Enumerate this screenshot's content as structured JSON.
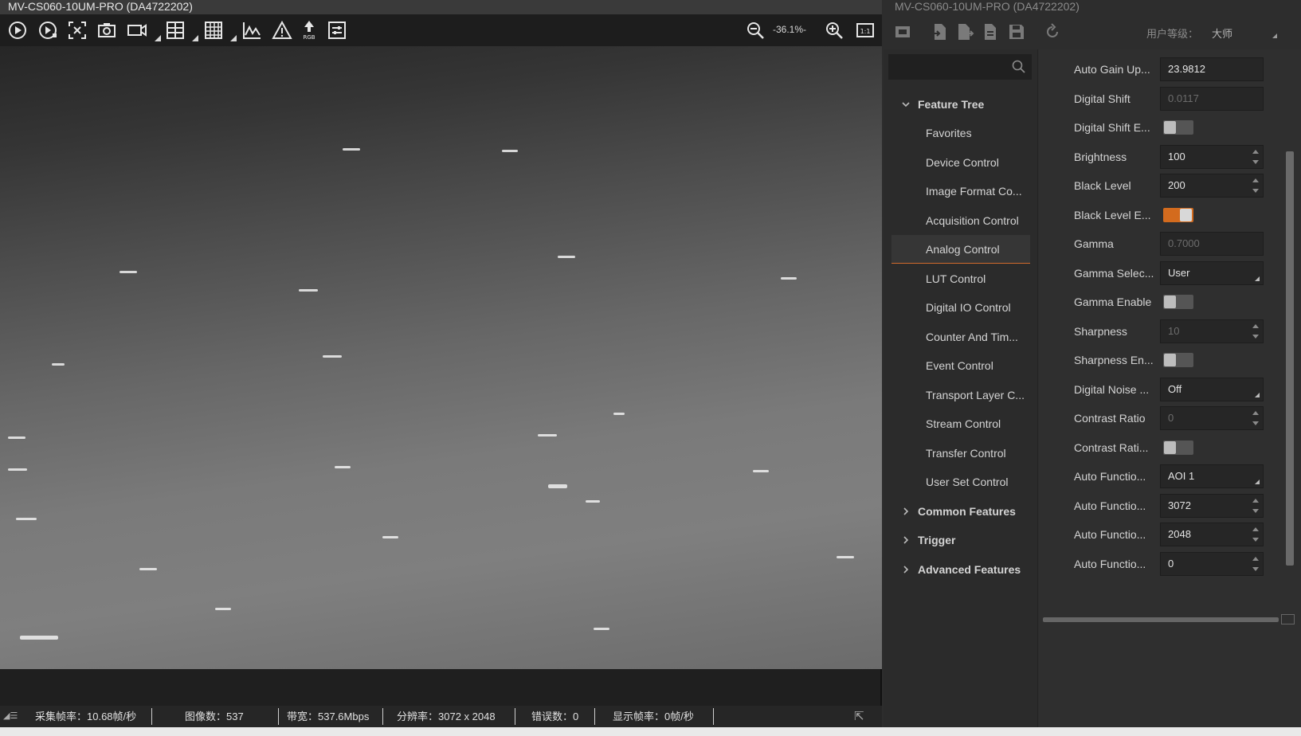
{
  "viewer": {
    "title": "MV-CS060-10UM-PRO (DA4722202)",
    "zoom": "-36.1%-",
    "toolbar": [
      "play-icon",
      "play-single-icon",
      "crosshair-icon",
      "camera-icon",
      "record-icon",
      "grid-small-icon",
      "grid-large-icon",
      "histogram-icon",
      "warning-icon",
      "rgb-icon",
      "settings-panel-icon"
    ]
  },
  "status": {
    "frame_rate": "采集帧率：10.68帧/秒",
    "image_count": "图像数：537",
    "bandwidth": "带宽：537.6Mbps",
    "resolution": "分辨率：3072 x 2048",
    "errors": "错误数：0",
    "display_rate": "显示帧率：0帧/秒"
  },
  "panel": {
    "title": "MV-CS060-10UM-PRO (DA4722202)",
    "user_level_label": "用户等级：",
    "user_level_value": "大师",
    "search_placeholder": ""
  },
  "tree": {
    "feature_tree": "Feature Tree",
    "children": [
      "Favorites",
      "Device Control",
      "Image Format Co...",
      "Acquisition Control",
      "Analog Control",
      "LUT Control",
      "Digital IO Control",
      "Counter And Tim...",
      "Event Control",
      "Transport Layer C...",
      "Stream Control",
      "Transfer Control",
      "User Set Control"
    ],
    "selected": "Analog Control",
    "groups": [
      "Common Features",
      "Trigger",
      "Advanced Features"
    ]
  },
  "props": [
    {
      "label": "Auto Gain Up...",
      "type": "text",
      "value": "23.9812",
      "disabled": false
    },
    {
      "label": "Digital Shift",
      "type": "text",
      "value": "0.0117",
      "disabled": true
    },
    {
      "label": "Digital Shift E...",
      "type": "toggle",
      "on": false
    },
    {
      "label": "Brightness",
      "type": "spin",
      "value": "100",
      "disabled": false
    },
    {
      "label": "Black Level",
      "type": "spin",
      "value": "200",
      "disabled": false
    },
    {
      "label": "Black Level E...",
      "type": "toggle",
      "on": true
    },
    {
      "label": "Gamma",
      "type": "text",
      "value": "0.7000",
      "disabled": true
    },
    {
      "label": "Gamma Selec...",
      "type": "combo",
      "value": "User",
      "disabled": false
    },
    {
      "label": "Gamma Enable",
      "type": "toggle",
      "on": false
    },
    {
      "label": "Sharpness",
      "type": "spin",
      "value": "10",
      "disabled": true
    },
    {
      "label": "Sharpness En...",
      "type": "toggle",
      "on": false
    },
    {
      "label": "Digital Noise ...",
      "type": "combo",
      "value": "Off",
      "disabled": false
    },
    {
      "label": "Contrast Ratio",
      "type": "spin",
      "value": "0",
      "disabled": true
    },
    {
      "label": "Contrast Rati...",
      "type": "toggle",
      "on": false
    },
    {
      "label": "Auto Functio...",
      "type": "combo",
      "value": "AOI 1",
      "disabled": false
    },
    {
      "label": "Auto Functio...",
      "type": "spin",
      "value": "3072",
      "disabled": false
    },
    {
      "label": "Auto Functio...",
      "type": "spin",
      "value": "2048",
      "disabled": false
    },
    {
      "label": "Auto Functio...",
      "type": "spin",
      "value": "0",
      "disabled": false
    }
  ],
  "colors": {
    "accent": "#d36b1e",
    "panel_bg": "#2d2d2d",
    "viewer_bg": "#1f1f1f"
  }
}
